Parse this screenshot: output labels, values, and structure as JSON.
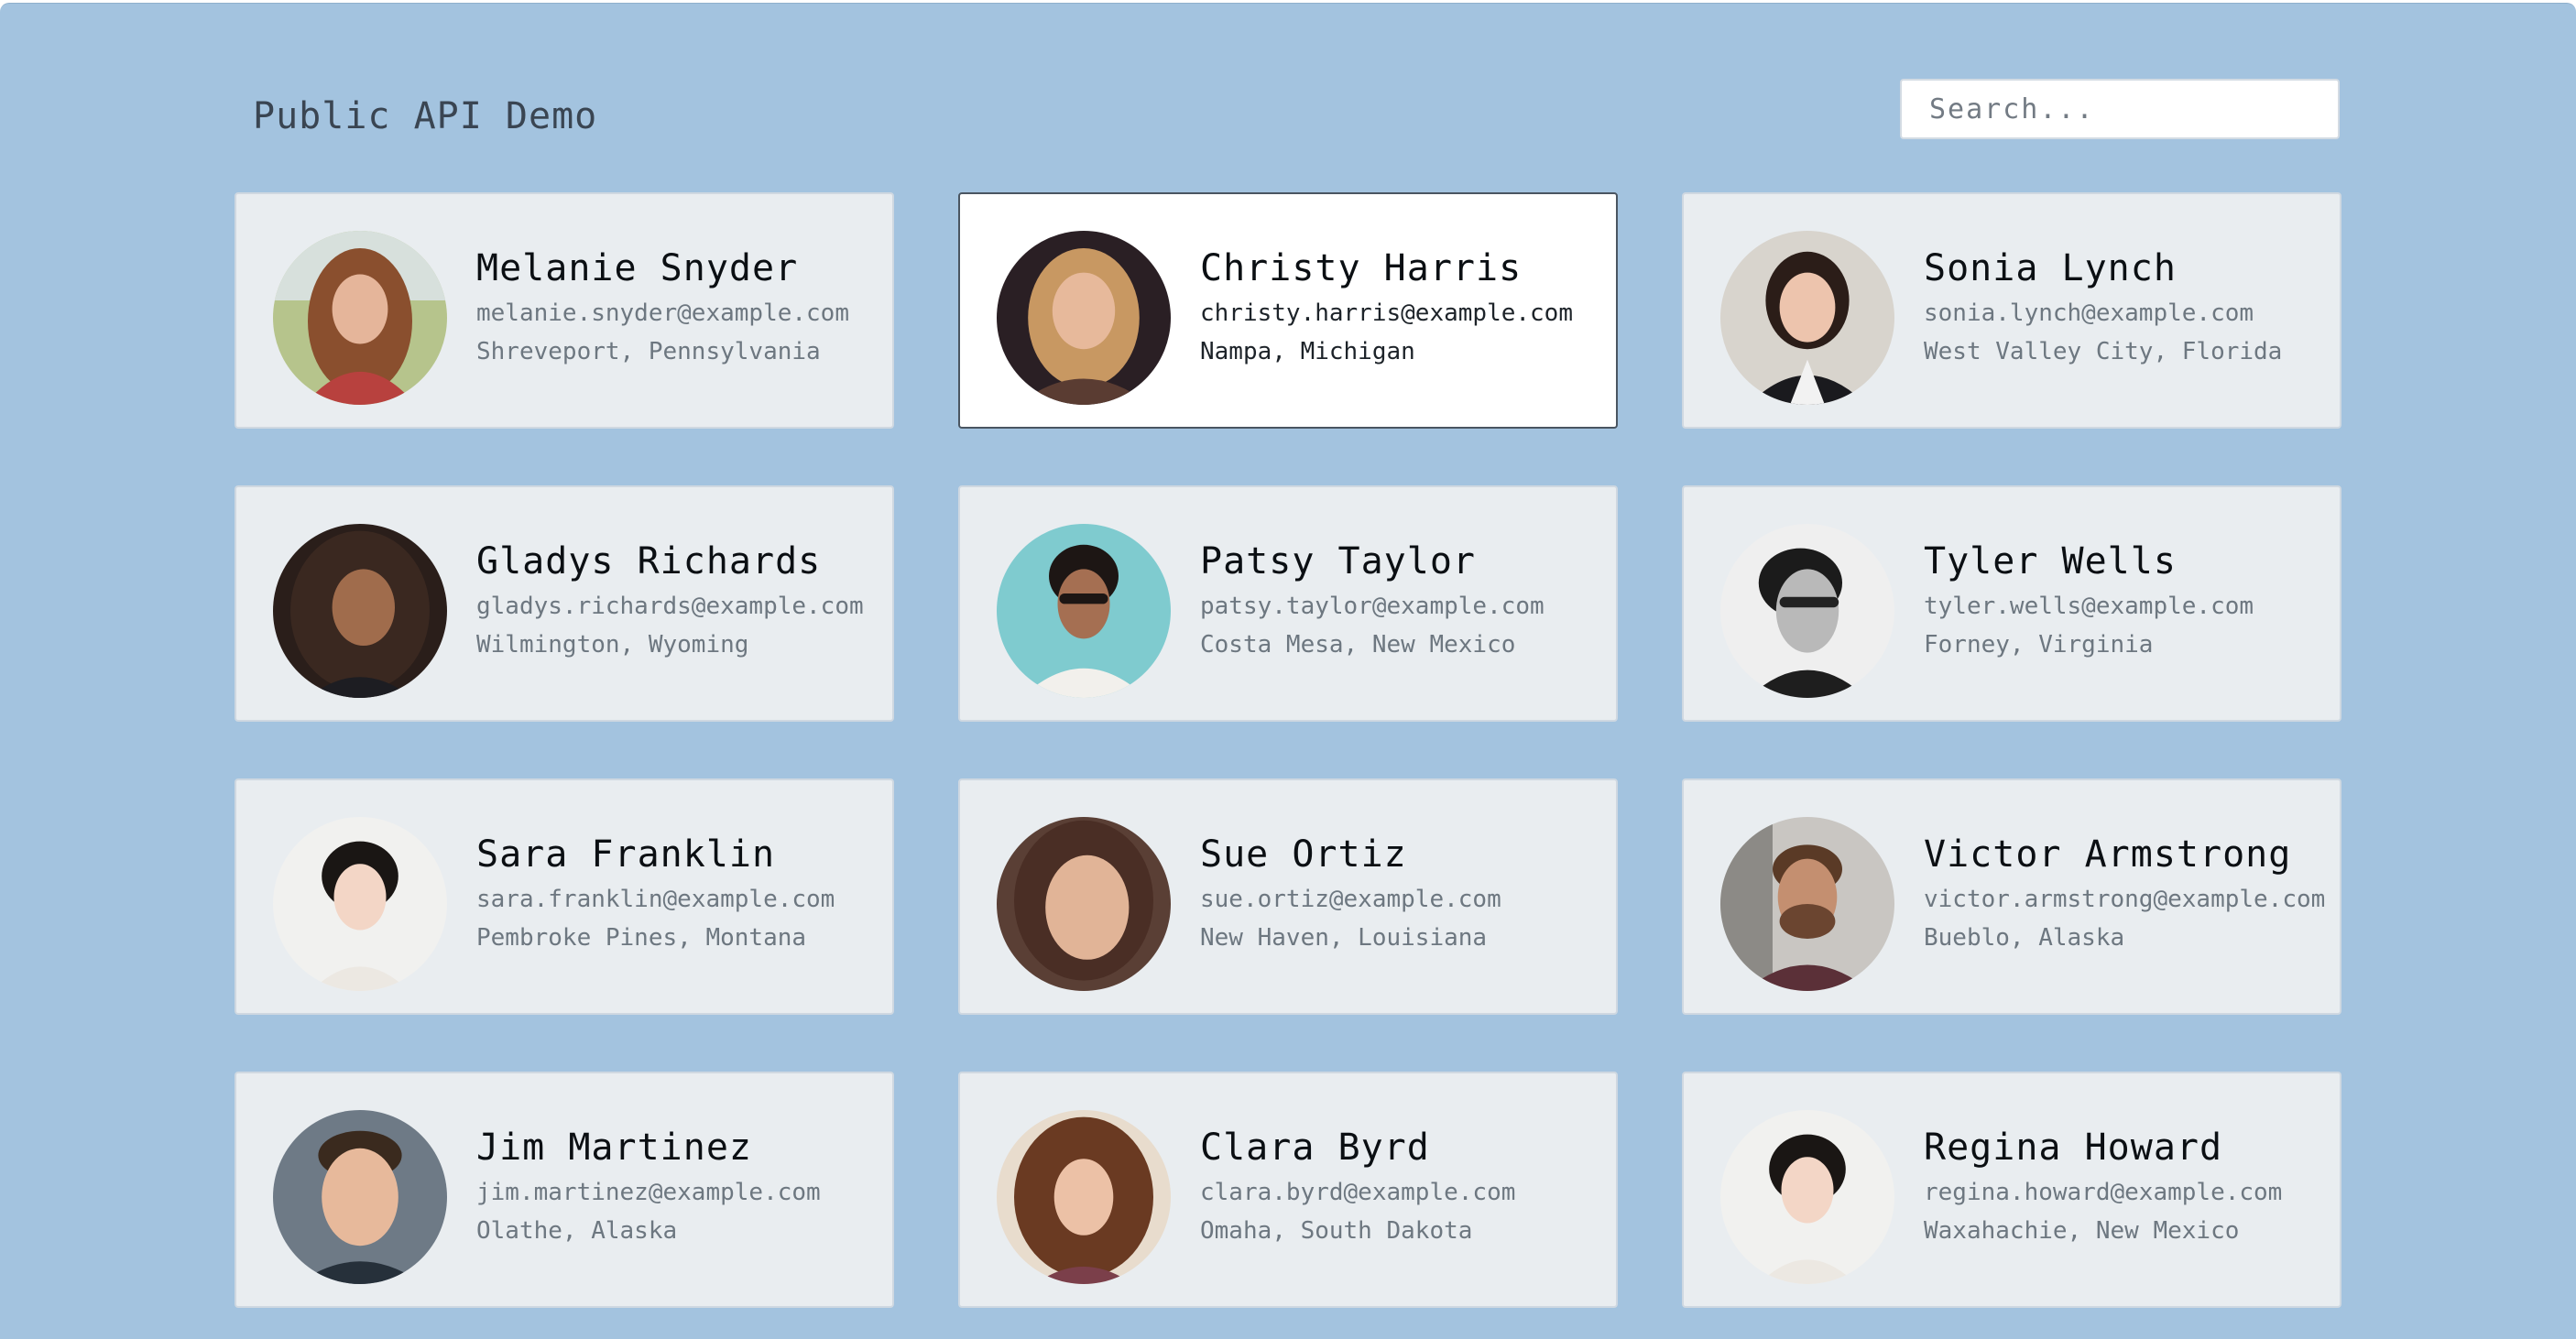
{
  "header": {
    "title": "Public API Demo",
    "search_placeholder": "Search..."
  },
  "colors": {
    "background": "#a3c3df",
    "card": "#e9edf0",
    "card_selected": "#ffffff"
  },
  "users": [
    {
      "name": "Melanie Snyder",
      "email": "melanie.snyder@example.com",
      "location": "Shreveport, Pennsylvania",
      "selected": false,
      "avatar": "avatar-photo"
    },
    {
      "name": "Christy Harris",
      "email": "christy.harris@example.com",
      "location": "Nampa, Michigan",
      "selected": true,
      "avatar": "avatar-photo"
    },
    {
      "name": "Sonia Lynch",
      "email": "sonia.lynch@example.com",
      "location": "West Valley City, Florida",
      "selected": false,
      "avatar": "avatar-photo"
    },
    {
      "name": "Gladys Richards",
      "email": "gladys.richards@example.com",
      "location": "Wilmington, Wyoming",
      "selected": false,
      "avatar": "avatar-photo"
    },
    {
      "name": "Patsy Taylor",
      "email": "patsy.taylor@example.com",
      "location": "Costa Mesa, New Mexico",
      "selected": false,
      "avatar": "avatar-photo"
    },
    {
      "name": "Tyler Wells",
      "email": "tyler.wells@example.com",
      "location": "Forney, Virginia",
      "selected": false,
      "avatar": "avatar-photo"
    },
    {
      "name": "Sara Franklin",
      "email": "sara.franklin@example.com",
      "location": "Pembroke Pines, Montana",
      "selected": false,
      "avatar": "avatar-photo"
    },
    {
      "name": "Sue Ortiz",
      "email": "sue.ortiz@example.com",
      "location": "New Haven, Louisiana",
      "selected": false,
      "avatar": "avatar-photo"
    },
    {
      "name": "Victor Armstrong",
      "email": "victor.armstrong@example.com",
      "location": "Bueblo, Alaska",
      "selected": false,
      "avatar": "avatar-photo"
    },
    {
      "name": "Jim Martinez",
      "email": "jim.martinez@example.com",
      "location": "Olathe, Alaska",
      "selected": false,
      "avatar": "avatar-photo"
    },
    {
      "name": "Clara Byrd",
      "email": "clara.byrd@example.com",
      "location": "Omaha, South Dakota",
      "selected": false,
      "avatar": "avatar-photo"
    },
    {
      "name": "Regina Howard",
      "email": "regina.howard@example.com",
      "location": "Waxahachie, New Mexico",
      "selected": false,
      "avatar": "avatar-photo"
    }
  ]
}
